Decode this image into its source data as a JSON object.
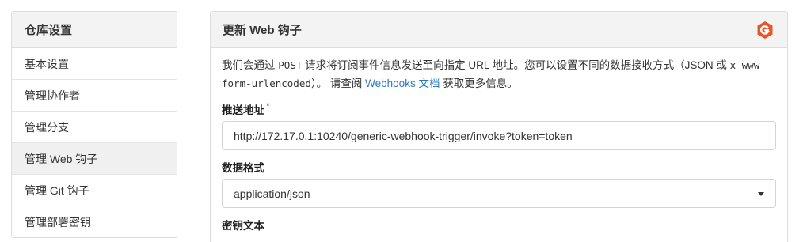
{
  "sidebar": {
    "title": "仓库设置",
    "items": [
      {
        "label": "基本设置"
      },
      {
        "label": "管理协作者"
      },
      {
        "label": "管理分支"
      },
      {
        "label": "管理 Web 钩子"
      },
      {
        "label": "管理 Git 钩子"
      },
      {
        "label": "管理部署密钥"
      }
    ]
  },
  "panel": {
    "title": "更新 Web 钩子",
    "logo_icon": "gitea-logo-icon",
    "description": {
      "part1": "我们会通过 ",
      "post": "POST",
      "part2": " 请求将订阅事件信息发送至向指定 URL 地址。您可以设置不同的数据接收方式（JSON 或 ",
      "format": "x-www-form-urlencoded",
      "part3": "）。 请查阅 ",
      "link": "Webhooks 文档",
      "part4": " 获取更多信息。"
    },
    "payload_url": {
      "label": "推送地址",
      "required_mark": "*",
      "value": "http://172.17.0.1:10240/generic-webhook-trigger/invoke?token=token"
    },
    "content_type": {
      "label": "数据格式",
      "value": "application/json"
    },
    "secret": {
      "label": "密钥文本"
    }
  },
  "colors": {
    "accent_link": "#2b7ac0",
    "required": "#db2828",
    "logo": "#e8542b"
  }
}
